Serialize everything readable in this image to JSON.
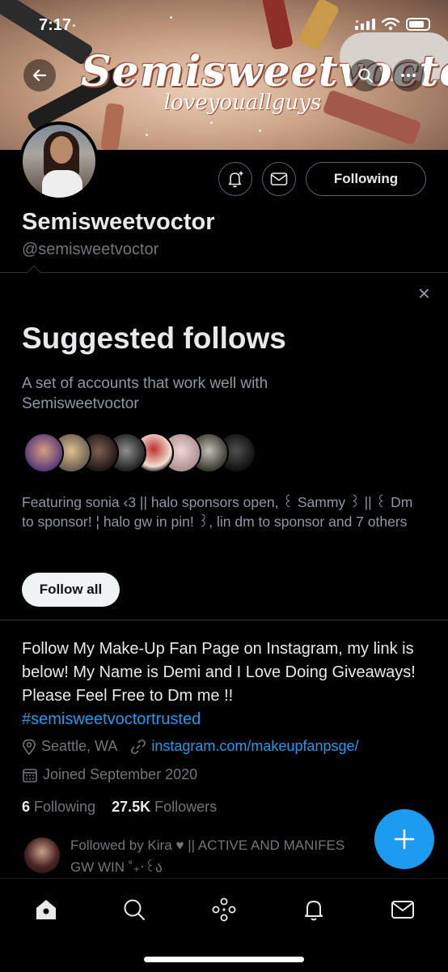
{
  "status_bar": {
    "time": "7:17"
  },
  "banner": {
    "title": "Semisweetvoctor",
    "subtitle": "loveyouallguys"
  },
  "profile": {
    "display_name": "Semisweetvoctor",
    "handle": "@semisweetvoctor",
    "following_button": "Following"
  },
  "suggested": {
    "title": "Suggested follows",
    "description": "A set of accounts that work well with Semisweetvoctor",
    "featuring": "Featuring sonia ‹3 || halo sponsors open, ꒰ Sammy ꒱ || ꒰ Dm to sponsor! ¦ halo gw in pin! ꒱, lin dm to sponsor and 7 others",
    "follow_all": "Follow all",
    "close_icon": "×"
  },
  "bio": {
    "text": "Follow My Make-Up Fan Page on Instagram, my link is below! My Name is Demi and I Love Doing Giveaways! Please Feel Free to Dm me !!",
    "hashtag": "#semisweetvoctortrusted",
    "location": "Seattle, WA",
    "link": "instagram.com/makeupfanpsge/",
    "joined": "Joined September 2020"
  },
  "counts": {
    "following_count": "6",
    "following_label": "Following",
    "followers_count": "27.5K",
    "followers_label": "Followers"
  },
  "followed_by": {
    "text": "Followed by Kira ♥ || ACTIVE AND MANIFES",
    "text2": "GW WIN ˚₊‧꒰ა"
  },
  "colors": {
    "accent": "#1d9bf0",
    "background": "#000000",
    "secondary_text": "#71767b"
  }
}
